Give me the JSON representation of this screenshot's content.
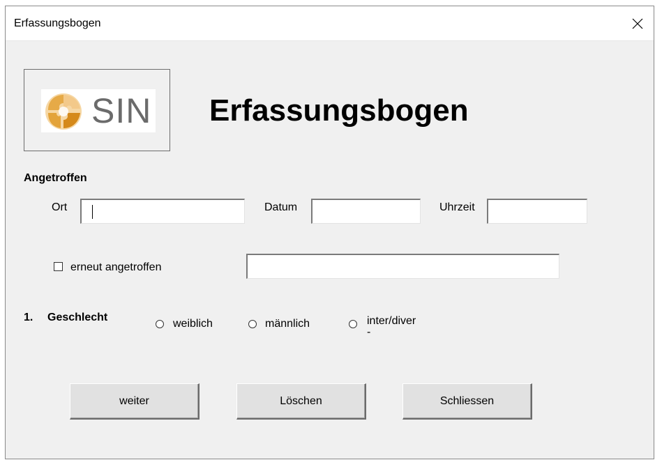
{
  "window": {
    "title": "Erfassungsbogen",
    "close_icon": "close-icon"
  },
  "logo": {
    "text": "SIN",
    "icon": "puzzle-logo-icon",
    "colors": [
      "#e3a33a",
      "#d58a1a",
      "#f3c98a"
    ]
  },
  "header": {
    "title": "Erfassungsbogen"
  },
  "section": {
    "label": "Angetroffen"
  },
  "fields": {
    "ort_label": "Ort",
    "ort_value": "",
    "datum_label": "Datum",
    "datum_value": "",
    "uhrzeit_label": "Uhrzeit",
    "uhrzeit_value": "",
    "erneut_label": "erneut angetroffen",
    "erneut_checked": false,
    "erneut_value": ""
  },
  "question1": {
    "number": "1.",
    "text": "Geschlecht",
    "options": [
      "weiblich",
      "männlich",
      "inter/diver",
      "-"
    ]
  },
  "buttons": {
    "weiter": "weiter",
    "loeschen": "Löschen",
    "schliessen": "Schliessen"
  }
}
